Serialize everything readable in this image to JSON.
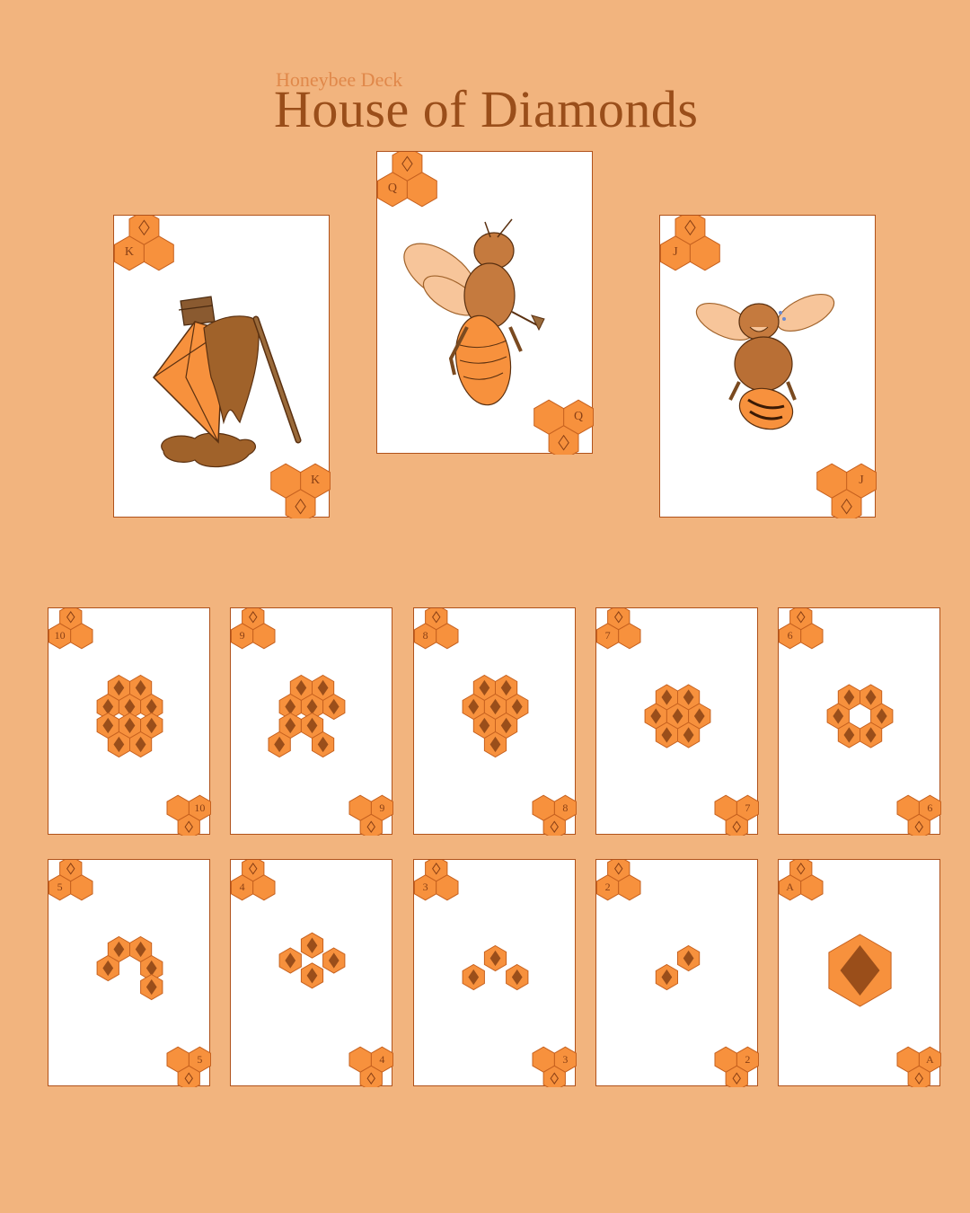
{
  "header": {
    "subtitle": "Honeybee Deck",
    "title": "House of  Diamonds"
  },
  "colors": {
    "background": "#f2b47e",
    "hex_fill": "#f7913d",
    "hex_stroke": "#c6611f",
    "pip": "#9a4e1a",
    "title": "#9a4e1a"
  },
  "court_cards": [
    {
      "rank": "K",
      "art": "melting-diamond-honey"
    },
    {
      "rank": "Q",
      "art": "queen-bee-with-axe"
    },
    {
      "rank": "J",
      "art": "laughing-drone-bee"
    }
  ],
  "pip_cards": [
    {
      "rank": "10",
      "pips": 10
    },
    {
      "rank": "9",
      "pips": 9
    },
    {
      "rank": "8",
      "pips": 8
    },
    {
      "rank": "7",
      "pips": 7
    },
    {
      "rank": "6",
      "pips": 6
    },
    {
      "rank": "5",
      "pips": 5
    },
    {
      "rank": "4",
      "pips": 4
    },
    {
      "rank": "3",
      "pips": 3
    },
    {
      "rank": "2",
      "pips": 2
    },
    {
      "rank": "A",
      "pips": 1
    }
  ]
}
